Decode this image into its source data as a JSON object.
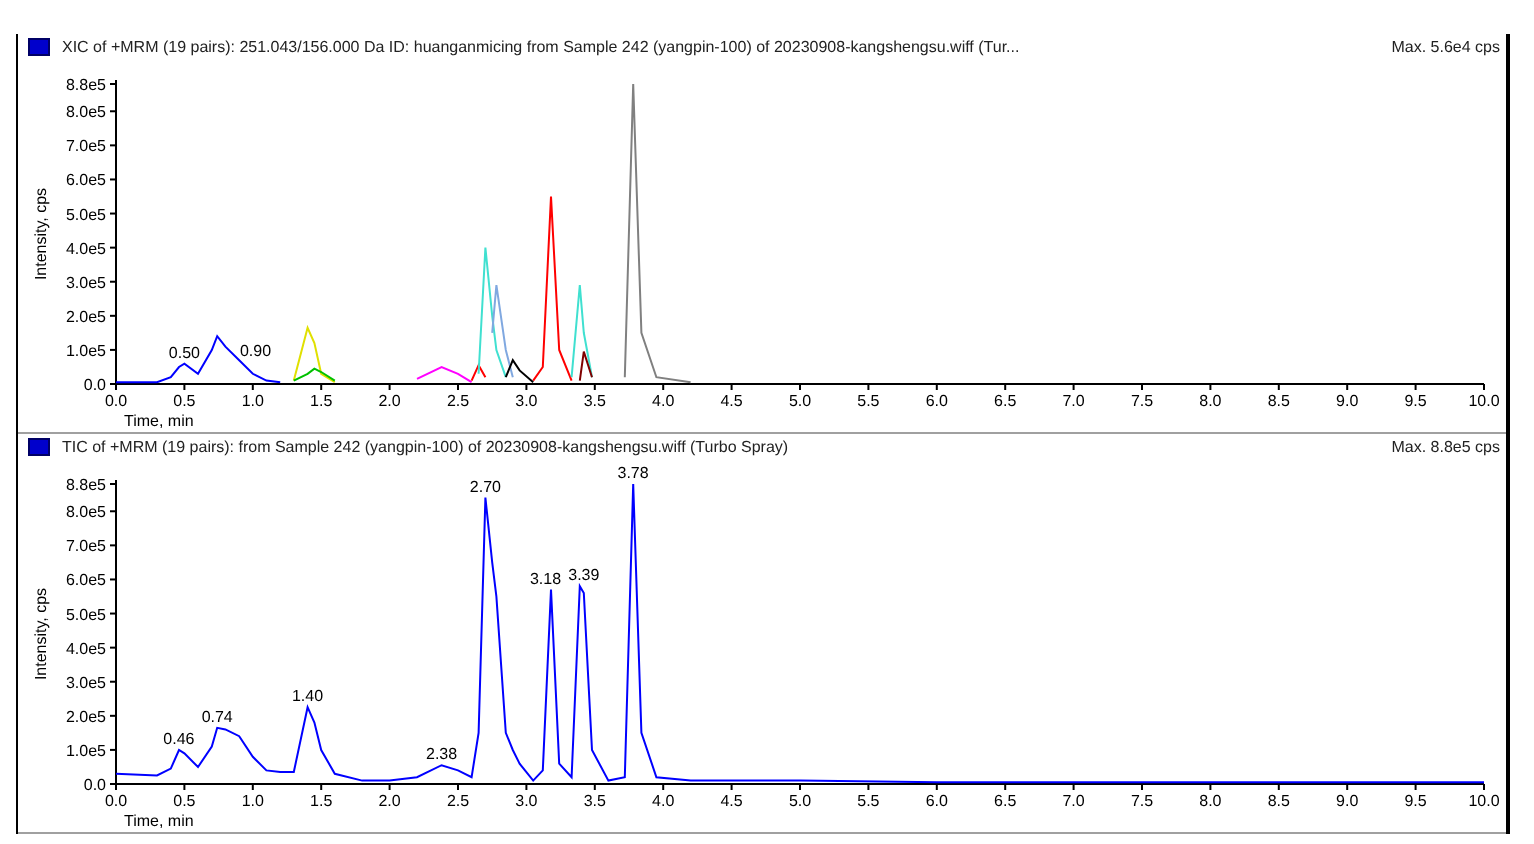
{
  "panels": [
    {
      "title": "XIC of +MRM (19 pairs): 251.043/156.000 Da ID: huanganmicing from Sample 242 (yangpin-100) of 20230908-kangshengsu.wiff (Tur...",
      "max": "Max. 5.6e4 cps",
      "chart_data": {
        "type": "line",
        "xlabel": "Time, min",
        "ylabel": "Intensity, cps",
        "x": [
          0,
          0.3,
          0.4,
          0.46,
          0.5,
          0.6,
          0.7,
          0.74,
          0.8,
          0.9,
          1.0,
          1.1,
          1.2,
          1.3,
          1.4,
          1.45,
          1.5,
          1.6,
          2.2,
          2.38,
          2.5,
          2.6,
          2.65,
          2.7,
          2.75,
          2.78,
          2.85,
          2.9,
          2.95,
          3.05,
          3.12,
          3.18,
          3.24,
          3.33,
          3.39,
          3.42,
          3.48,
          3.72,
          3.78,
          3.84,
          3.95,
          4.2
        ],
        "xlim": [
          0,
          10
        ],
        "ylim": [
          0,
          880000.0
        ],
        "xticks": [
          {
            "value": 0,
            "label": "0.0"
          },
          {
            "value": 0.5,
            "label": "0.5"
          },
          {
            "value": 1,
            "label": "1.0"
          },
          {
            "value": 1.5,
            "label": "1.5"
          },
          {
            "value": 2,
            "label": "2.0"
          },
          {
            "value": 2.5,
            "label": "2.5"
          },
          {
            "value": 3,
            "label": "3.0"
          },
          {
            "value": 3.5,
            "label": "3.5"
          },
          {
            "value": 4,
            "label": "4.0"
          },
          {
            "value": 4.5,
            "label": "4.5"
          },
          {
            "value": 5,
            "label": "5.0"
          },
          {
            "value": 5.5,
            "label": "5.5"
          },
          {
            "value": 6,
            "label": "6.0"
          },
          {
            "value": 6.5,
            "label": "6.5"
          },
          {
            "value": 7,
            "label": "7.0"
          },
          {
            "value": 7.5,
            "label": "7.5"
          },
          {
            "value": 8,
            "label": "8.0"
          },
          {
            "value": 8.5,
            "label": "8.5"
          },
          {
            "value": 9,
            "label": "9.0"
          },
          {
            "value": 9.5,
            "label": "9.5"
          },
          {
            "value": 10,
            "label": "10.0"
          }
        ],
        "yticks": [
          {
            "value": 0,
            "label": "0.0"
          },
          {
            "value": 100000.0,
            "label": "1.0e5"
          },
          {
            "value": 200000.0,
            "label": "2.0e5"
          },
          {
            "value": 300000.0,
            "label": "3.0e5"
          },
          {
            "value": 400000.0,
            "label": "4.0e5"
          },
          {
            "value": 500000.0,
            "label": "5.0e5"
          },
          {
            "value": 600000.0,
            "label": "6.0e5"
          },
          {
            "value": 700000.0,
            "label": "7.0e5"
          },
          {
            "value": 800000.0,
            "label": "8.0e5"
          },
          {
            "value": 880000.0,
            "label": "8.8e5"
          }
        ],
        "series": [
          {
            "color": "#0000ff",
            "values": [
              5000,
              5000,
              20000,
              50000,
              60000,
              30000,
              100000,
              140000,
              110000,
              70000,
              30000,
              10000,
              5000,
              null,
              null,
              null,
              null,
              null,
              null,
              null,
              null,
              null,
              null,
              null,
              null,
              null,
              null,
              null,
              null,
              null,
              null,
              null,
              null,
              null,
              null,
              null,
              null,
              null,
              null,
              null,
              null,
              null
            ]
          },
          {
            "color": "#e0e000",
            "values": [
              null,
              null,
              null,
              null,
              null,
              null,
              null,
              null,
              null,
              null,
              null,
              null,
              null,
              10000,
              165000,
              120000,
              30000,
              5000,
              null,
              null,
              null,
              null,
              null,
              null,
              null,
              null,
              null,
              null,
              null,
              null,
              null,
              null,
              null,
              null,
              null,
              null,
              null,
              null,
              null,
              null,
              null,
              null
            ]
          },
          {
            "color": "#00c000",
            "values": [
              null,
              null,
              null,
              null,
              null,
              null,
              null,
              null,
              null,
              null,
              null,
              null,
              null,
              10000,
              30000,
              45000,
              35000,
              10000,
              null,
              null,
              null,
              null,
              null,
              null,
              null,
              null,
              null,
              null,
              null,
              null,
              null,
              null,
              null,
              null,
              null,
              null,
              null,
              null,
              null,
              null,
              null,
              null
            ]
          },
          {
            "color": "#ff00ff",
            "values": [
              null,
              null,
              null,
              null,
              null,
              null,
              null,
              null,
              null,
              null,
              null,
              null,
              null,
              null,
              null,
              null,
              null,
              null,
              15000,
              50000,
              30000,
              5000,
              null,
              null,
              null,
              null,
              null,
              null,
              null,
              null,
              null,
              null,
              null,
              null,
              null,
              null,
              null,
              null,
              null,
              null,
              null,
              null
            ]
          },
          {
            "color": "#ff0000",
            "values": [
              null,
              null,
              null,
              null,
              null,
              null,
              null,
              null,
              null,
              null,
              null,
              null,
              null,
              null,
              null,
              null,
              null,
              null,
              null,
              null,
              null,
              10000,
              55000,
              20000,
              null,
              null,
              null,
              null,
              null,
              10000,
              50000,
              550000,
              100000,
              10000,
              null,
              null,
              null,
              null,
              null,
              null,
              null,
              null
            ]
          },
          {
            "color": "#40e0d0",
            "values": [
              null,
              null,
              null,
              null,
              null,
              null,
              null,
              null,
              null,
              null,
              null,
              null,
              null,
              null,
              null,
              null,
              null,
              null,
              null,
              null,
              null,
              null,
              30000,
              400000,
              200000,
              100000,
              20000,
              null,
              null,
              null,
              null,
              null,
              null,
              20000,
              290000,
              150000,
              20000,
              null,
              null,
              null,
              null,
              null
            ]
          },
          {
            "color": "#80a8e0",
            "values": [
              null,
              null,
              null,
              null,
              null,
              null,
              null,
              null,
              null,
              null,
              null,
              null,
              null,
              null,
              null,
              null,
              null,
              null,
              null,
              null,
              null,
              null,
              null,
              null,
              150000,
              290000,
              100000,
              20000,
              null,
              null,
              null,
              null,
              null,
              null,
              null,
              null,
              null,
              null,
              null,
              null,
              null,
              null
            ]
          },
          {
            "color": "#000000",
            "values": [
              null,
              null,
              null,
              null,
              null,
              null,
              null,
              null,
              null,
              null,
              null,
              null,
              null,
              null,
              null,
              null,
              null,
              null,
              null,
              null,
              null,
              null,
              null,
              null,
              null,
              null,
              20000,
              70000,
              40000,
              5000,
              null,
              null,
              null,
              null,
              null,
              null,
              null,
              null,
              null,
              null,
              null,
              null
            ]
          },
          {
            "color": "#800000",
            "values": [
              null,
              null,
              null,
              null,
              null,
              null,
              null,
              null,
              null,
              null,
              null,
              null,
              null,
              null,
              null,
              null,
              null,
              null,
              null,
              null,
              null,
              null,
              null,
              null,
              null,
              null,
              null,
              null,
              null,
              null,
              null,
              null,
              null,
              null,
              10000,
              95000,
              20000,
              null,
              null,
              null,
              null,
              null
            ]
          },
          {
            "color": "#808080",
            "values": [
              null,
              null,
              null,
              null,
              null,
              null,
              null,
              null,
              null,
              null,
              null,
              null,
              null,
              null,
              null,
              null,
              null,
              null,
              null,
              null,
              null,
              null,
              null,
              null,
              null,
              null,
              null,
              null,
              null,
              null,
              null,
              null,
              null,
              null,
              null,
              null,
              null,
              20000,
              880000,
              150000,
              20000,
              5000
            ]
          }
        ],
        "annotations": [
          {
            "x": 0.5,
            "y": 60000,
            "text": "0.50"
          },
          {
            "x": 1.02,
            "y": 65000,
            "text": "0.90"
          }
        ]
      }
    },
    {
      "title": "TIC of +MRM (19 pairs): from Sample 242 (yangpin-100) of 20230908-kangshengsu.wiff (Turbo Spray)",
      "max": "Max. 8.8e5 cps",
      "chart_data": {
        "type": "line",
        "xlabel": "Time, min",
        "ylabel": "Intensity, cps",
        "x": [
          0,
          0.3,
          0.4,
          0.46,
          0.5,
          0.6,
          0.7,
          0.74,
          0.8,
          0.9,
          1.0,
          1.1,
          1.2,
          1.3,
          1.4,
          1.45,
          1.5,
          1.6,
          1.8,
          2.0,
          2.2,
          2.38,
          2.5,
          2.6,
          2.65,
          2.7,
          2.75,
          2.78,
          2.85,
          2.9,
          2.95,
          3.05,
          3.12,
          3.18,
          3.24,
          3.33,
          3.39,
          3.42,
          3.48,
          3.6,
          3.72,
          3.78,
          3.84,
          3.95,
          4.2,
          5,
          6,
          7,
          8,
          9,
          10
        ],
        "xlim": [
          0,
          10
        ],
        "ylim": [
          0,
          880000.0
        ],
        "xticks": [
          {
            "value": 0,
            "label": "0.0"
          },
          {
            "value": 0.5,
            "label": "0.5"
          },
          {
            "value": 1,
            "label": "1.0"
          },
          {
            "value": 1.5,
            "label": "1.5"
          },
          {
            "value": 2,
            "label": "2.0"
          },
          {
            "value": 2.5,
            "label": "2.5"
          },
          {
            "value": 3,
            "label": "3.0"
          },
          {
            "value": 3.5,
            "label": "3.5"
          },
          {
            "value": 4,
            "label": "4.0"
          },
          {
            "value": 4.5,
            "label": "4.5"
          },
          {
            "value": 5,
            "label": "5.0"
          },
          {
            "value": 5.5,
            "label": "5.5"
          },
          {
            "value": 6,
            "label": "6.0"
          },
          {
            "value": 6.5,
            "label": "6.5"
          },
          {
            "value": 7,
            "label": "7.0"
          },
          {
            "value": 7.5,
            "label": "7.5"
          },
          {
            "value": 8,
            "label": "8.0"
          },
          {
            "value": 8.5,
            "label": "8.5"
          },
          {
            "value": 9,
            "label": "9.0"
          },
          {
            "value": 9.5,
            "label": "9.5"
          },
          {
            "value": 10,
            "label": "10.0"
          }
        ],
        "yticks": [
          {
            "value": 0,
            "label": "0.0"
          },
          {
            "value": 100000.0,
            "label": "1.0e5"
          },
          {
            "value": 200000.0,
            "label": "2.0e5"
          },
          {
            "value": 300000.0,
            "label": "3.0e5"
          },
          {
            "value": 400000.0,
            "label": "4.0e5"
          },
          {
            "value": 500000.0,
            "label": "5.0e5"
          },
          {
            "value": 600000.0,
            "label": "6.0e5"
          },
          {
            "value": 700000.0,
            "label": "7.0e5"
          },
          {
            "value": 800000.0,
            "label": "8.0e5"
          },
          {
            "value": 880000.0,
            "label": "8.8e5"
          }
        ],
        "series": [
          {
            "color": "#0000ff",
            "values": [
              30000,
              25000,
              45000,
              100000,
              90000,
              50000,
              110000,
              165000,
              160000,
              140000,
              80000,
              40000,
              35000,
              35000,
              225000,
              180000,
              100000,
              30000,
              10000,
              10000,
              20000,
              55000,
              40000,
              20000,
              150000,
              840000,
              650000,
              550000,
              150000,
              100000,
              60000,
              10000,
              40000,
              570000,
              60000,
              20000,
              580000,
              560000,
              100000,
              10000,
              20000,
              880000,
              150000,
              20000,
              10000,
              10000,
              5000,
              5000,
              5000,
              5000,
              5000
            ]
          }
        ],
        "annotations": [
          {
            "x": 0.46,
            "y": 100000,
            "text": "0.46"
          },
          {
            "x": 0.74,
            "y": 165000,
            "text": "0.74"
          },
          {
            "x": 1.4,
            "y": 225000,
            "text": "1.40"
          },
          {
            "x": 2.38,
            "y": 55000,
            "text": "2.38"
          },
          {
            "x": 2.7,
            "y": 840000,
            "text": "2.70"
          },
          {
            "x": 3.14,
            "y": 570000,
            "text": "3.18"
          },
          {
            "x": 3.42,
            "y": 580000,
            "text": "3.39"
          },
          {
            "x": 3.78,
            "y": 880000,
            "text": "3.78"
          }
        ]
      }
    }
  ]
}
